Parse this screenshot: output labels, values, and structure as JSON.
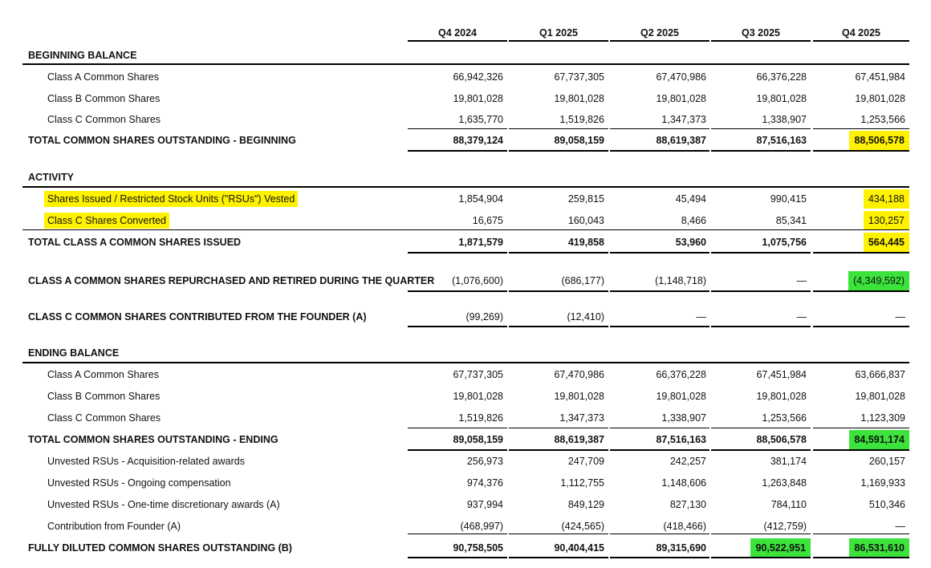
{
  "columns": [
    "Q4 2024",
    "Q1 2025",
    "Q2 2025",
    "Q3 2025",
    "Q4 2025"
  ],
  "sections": {
    "beginning": {
      "title": "BEGINNING BALANCE",
      "rows": [
        {
          "label": "Class A Common Shares",
          "values": [
            "66,942,326",
            "67,737,305",
            "67,470,986",
            "66,376,228",
            "67,451,984"
          ]
        },
        {
          "label": "Class B Common Shares",
          "values": [
            "19,801,028",
            "19,801,028",
            "19,801,028",
            "19,801,028",
            "19,801,028"
          ]
        },
        {
          "label": "Class C Common Shares",
          "values": [
            "1,635,770",
            "1,519,826",
            "1,347,373",
            "1,338,907",
            "1,253,566"
          ]
        }
      ],
      "total": {
        "label": "TOTAL COMMON SHARES OUTSTANDING - BEGINNING",
        "values": [
          "88,379,124",
          "89,058,159",
          "88,619,387",
          "87,516,163",
          "88,506,578"
        ]
      }
    },
    "activity": {
      "title": "ACTIVITY",
      "rows": [
        {
          "label": "Shares Issued / Restricted Stock Units (\"RSUs\") Vested",
          "values": [
            "1,854,904",
            "259,815",
            "45,494",
            "990,415",
            "434,188"
          ]
        },
        {
          "label": "Class C Shares Converted",
          "values": [
            "16,675",
            "160,043",
            "8,466",
            "85,341",
            "130,257"
          ]
        }
      ],
      "total": {
        "label": "TOTAL CLASS A COMMON SHARES ISSUED",
        "values": [
          "1,871,579",
          "419,858",
          "53,960",
          "1,075,756",
          "564,445"
        ]
      }
    },
    "repurchased": {
      "label": "CLASS A COMMON SHARES REPURCHASED AND RETIRED DURING THE QUARTER",
      "values": [
        "(1,076,600)",
        "(686,177)",
        "(1,148,718)",
        "—",
        "(4,349,592)"
      ]
    },
    "contributed": {
      "label": "CLASS C COMMON SHARES CONTRIBUTED FROM THE FOUNDER (A)",
      "values": [
        "(99,269)",
        "(12,410)",
        "—",
        "—",
        "—"
      ]
    },
    "ending": {
      "title": "ENDING BALANCE",
      "rows": [
        {
          "label": "Class A Common Shares",
          "values": [
            "67,737,305",
            "67,470,986",
            "66,376,228",
            "67,451,984",
            "63,666,837"
          ]
        },
        {
          "label": "Class B Common Shares",
          "values": [
            "19,801,028",
            "19,801,028",
            "19,801,028",
            "19,801,028",
            "19,801,028"
          ]
        },
        {
          "label": "Class C Common Shares",
          "values": [
            "1,519,826",
            "1,347,373",
            "1,338,907",
            "1,253,566",
            "1,123,309"
          ]
        }
      ],
      "total": {
        "label": "TOTAL COMMON SHARES OUTSTANDING - ENDING",
        "values": [
          "89,058,159",
          "88,619,387",
          "87,516,163",
          "88,506,578",
          "84,591,174"
        ]
      },
      "extra": [
        {
          "label": "Unvested RSUs - Acquisition-related awards",
          "values": [
            "256,973",
            "247,709",
            "242,257",
            "381,174",
            "260,157"
          ]
        },
        {
          "label": "Unvested RSUs - Ongoing compensation",
          "values": [
            "974,376",
            "1,112,755",
            "1,148,606",
            "1,263,848",
            "1,169,933"
          ]
        },
        {
          "label": "Unvested RSUs - One-time discretionary awards (A)",
          "values": [
            "937,994",
            "849,129",
            "827,130",
            "784,110",
            "510,346"
          ]
        },
        {
          "label": "Contribution from Founder (A)",
          "values": [
            "(468,997)",
            "(424,565)",
            "(418,466)",
            "(412,759)",
            "—"
          ]
        }
      ],
      "diluted": {
        "label": "FULLY DILUTED COMMON SHARES OUTSTANDING (B)",
        "values": [
          "90,758,505",
          "90,404,415",
          "89,315,690",
          "90,522,951",
          "86,531,610"
        ]
      }
    }
  },
  "highlight_colors": {
    "yellow": "#fff200",
    "green": "#3be33b"
  }
}
